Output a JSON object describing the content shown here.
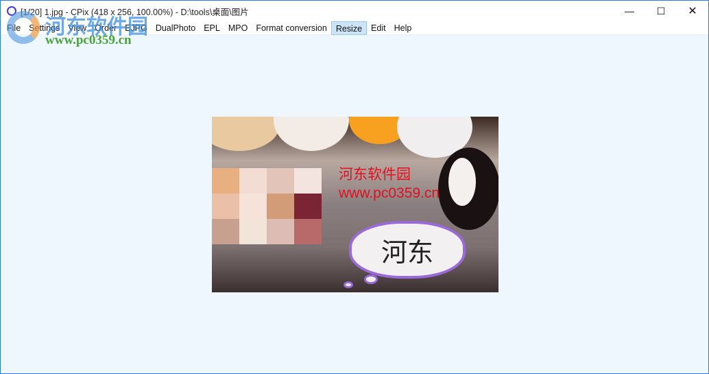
{
  "window": {
    "title": "[1/20] 1.jpg - CPix (418 x 256, 100.00%) - D:\\tools\\桌面\\图片",
    "controls": [
      "minimize",
      "maximize",
      "close"
    ]
  },
  "menu": {
    "items": [
      "File",
      "Settings",
      "View",
      "Order",
      "EJPG",
      "DualPhoto",
      "EPL",
      "MPO",
      "Format conversion",
      "Resize",
      "Edit",
      "Help"
    ],
    "active": "Resize"
  },
  "image": {
    "watermark_line1": "河东软件园",
    "watermark_line2": "www.pc0359.cn",
    "bubble_text": "河东"
  },
  "logo_overlay": {
    "name": "河东软件园",
    "url": "www.pc0359.cn"
  },
  "colors": {
    "border": "#2b7bd6",
    "canvas": "#eff7fe",
    "menu_active": "#cce4f7"
  }
}
